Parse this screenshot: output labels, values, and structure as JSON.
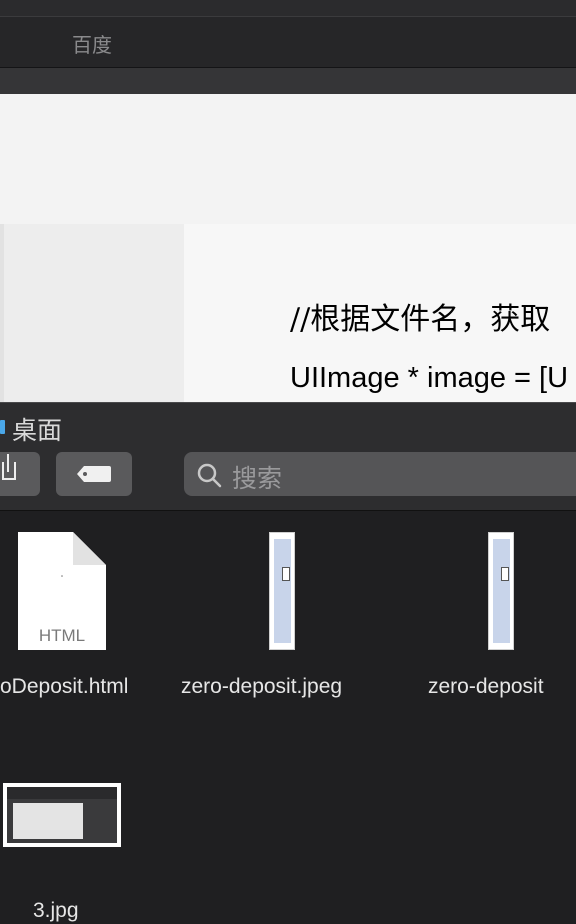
{
  "browser": {
    "bookmarks": [
      "百度"
    ]
  },
  "page": {
    "code_line_1": "//根据文件名，获取",
    "code_line_2": "UIImage * image = [U"
  },
  "finder": {
    "title": "桌面",
    "search_placeholder": "搜索",
    "files": [
      {
        "name": "oDeposit.html",
        "icon": "html-document-icon",
        "type_label": "HTML"
      },
      {
        "name": "zero-deposit.jpeg",
        "icon": "image-thumbnail"
      },
      {
        "name": "zero-deposit",
        "icon": "image-thumbnail"
      },
      {
        "name": "3.jpg",
        "icon": "image-thumbnail"
      }
    ]
  },
  "colors": {
    "background": "#1f1f21",
    "toolbar": "#2d2d2f",
    "folder_accent": "#4aa7e9"
  }
}
